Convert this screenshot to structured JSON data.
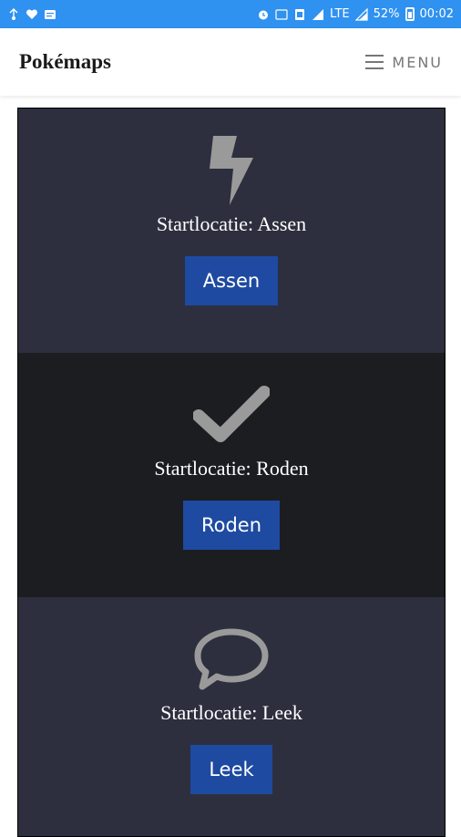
{
  "statusbar": {
    "battery": "52%",
    "time": "00:02",
    "network": "LTE"
  },
  "header": {
    "title": "Pokémaps",
    "menu_label": "MENU"
  },
  "sections": [
    {
      "icon": "lightning-icon",
      "label": "Startlocatie: Assen",
      "button": "Assen"
    },
    {
      "icon": "checkmark-icon",
      "label": "Startlocatie: Roden",
      "button": "Roden"
    },
    {
      "icon": "speech-bubble-icon",
      "label": "Startlocatie: Leek",
      "button": "Leek"
    }
  ],
  "colors": {
    "status_bar": "#2f91f0",
    "section_light": "#2d2f3e",
    "section_dark": "#1c1d21",
    "button": "#1e4aa1",
    "icon": "#9a9a9a"
  }
}
